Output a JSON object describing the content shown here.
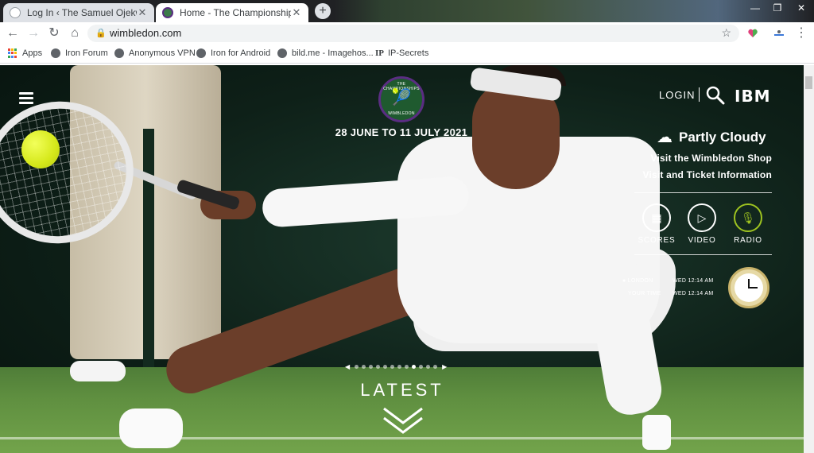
{
  "browser": {
    "tabs": [
      {
        "title": "Log In ‹ The Samuel Ojekwe Blog",
        "close": "✕",
        "active": false
      },
      {
        "title": "Home - The Championships, Wimbledon",
        "close": "✕",
        "active": true
      }
    ],
    "new_tab": "+",
    "window_controls": [
      "—",
      "❐",
      "✕"
    ],
    "url": "wimbledon.com",
    "bookmarks": [
      {
        "label": "Apps",
        "icon": "apps-grid-icon"
      },
      {
        "label": "Iron Forum",
        "icon": "globe-icon"
      },
      {
        "label": "Anonymous VPN",
        "icon": "globe-icon"
      },
      {
        "label": "Iron for Android",
        "icon": "globe-icon"
      },
      {
        "label": "bild.me - Imagehos...",
        "icon": "globe-icon"
      },
      {
        "label": "IP-Secrets",
        "icon": "ip-icon",
        "icon_text": "IP"
      }
    ]
  },
  "page": {
    "logo": {
      "top_text": "THE CHAMPIONSHIPS",
      "bottom_text": "WIMBLEDON",
      "glyph": "🎾"
    },
    "dates": "28 JUNE TO 11 JULY 2021",
    "login": "LOGIN",
    "sponsor": "IBM",
    "weather": "Partly Cloudy",
    "links": [
      "Visit the Wimbledon Shop",
      "Visit and Ticket Information"
    ],
    "media": [
      {
        "label": "SCORES",
        "icon": "scores-grid-icon"
      },
      {
        "label": "VIDEO",
        "icon": "play-icon"
      },
      {
        "label": "RADIO",
        "icon": "microphone-icon"
      }
    ],
    "times": [
      {
        "city": "LONDON",
        "time": "WED 12:14 AM"
      },
      {
        "city": "YOUR TIME",
        "time": "WED 12:14 AM"
      }
    ],
    "carousel": {
      "count": 12,
      "active_index": 8
    },
    "latest": "LATEST",
    "colors": {
      "wimbledon_purple": "#5a2d82",
      "wimbledon_green": "#1f5a2f",
      "radio_green": "#9ec320"
    }
  }
}
